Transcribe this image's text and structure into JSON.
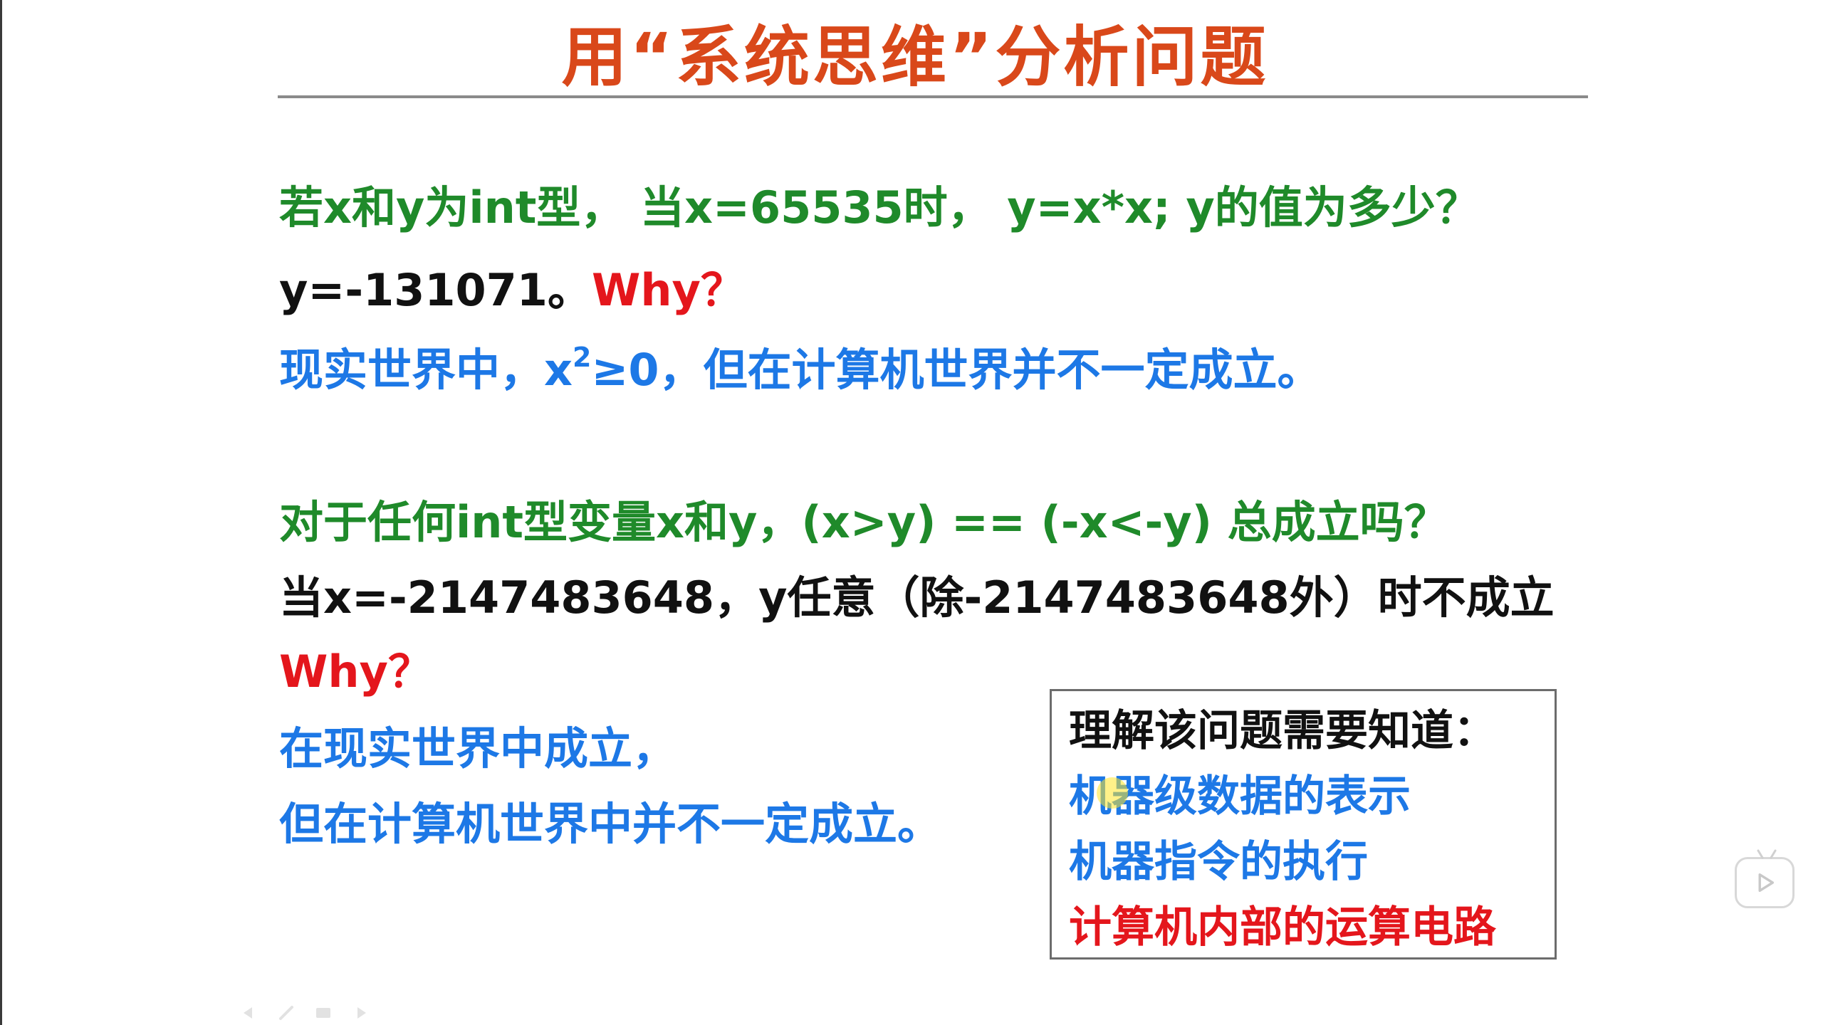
{
  "slide": {
    "title": "用“系统思维”分析问题",
    "q1": {
      "question": "若x和y为int型，  当x=65535时，  y=x*x;  y的值为多少？",
      "answer": "y=-131071。",
      "why": "Why？",
      "explain_before": "现实世界中，x",
      "explain_sup": "2",
      "explain_after": "≥0，但在计算机世界并不一定成立。"
    },
    "q2": {
      "question": "对于任何int型变量x和y，(x>y) == (-x<-y) 总成立吗？",
      "answer": "当x=-2147483648，y任意（除-2147483648外）时不成立",
      "why": "Why？",
      "explain_line1": "在现实世界中成立，",
      "explain_line2": "但在计算机世界中并不一定成立。"
    },
    "knowledge_box": {
      "heading": "理解该问题需要知道：",
      "items": [
        "机器级数据的表示",
        "机器指令的执行",
        "计算机内部的运算电路"
      ]
    }
  },
  "colors": {
    "title": "#d9481a",
    "question": "#1f8a2a",
    "answer": "#111111",
    "why": "#e4161c",
    "explain": "#1d78e6"
  },
  "overlay": {
    "play_icon": "play-icon",
    "tools": [
      "prev-arrow-icon",
      "pen-icon",
      "menu-icon",
      "next-arrow-icon"
    ]
  }
}
